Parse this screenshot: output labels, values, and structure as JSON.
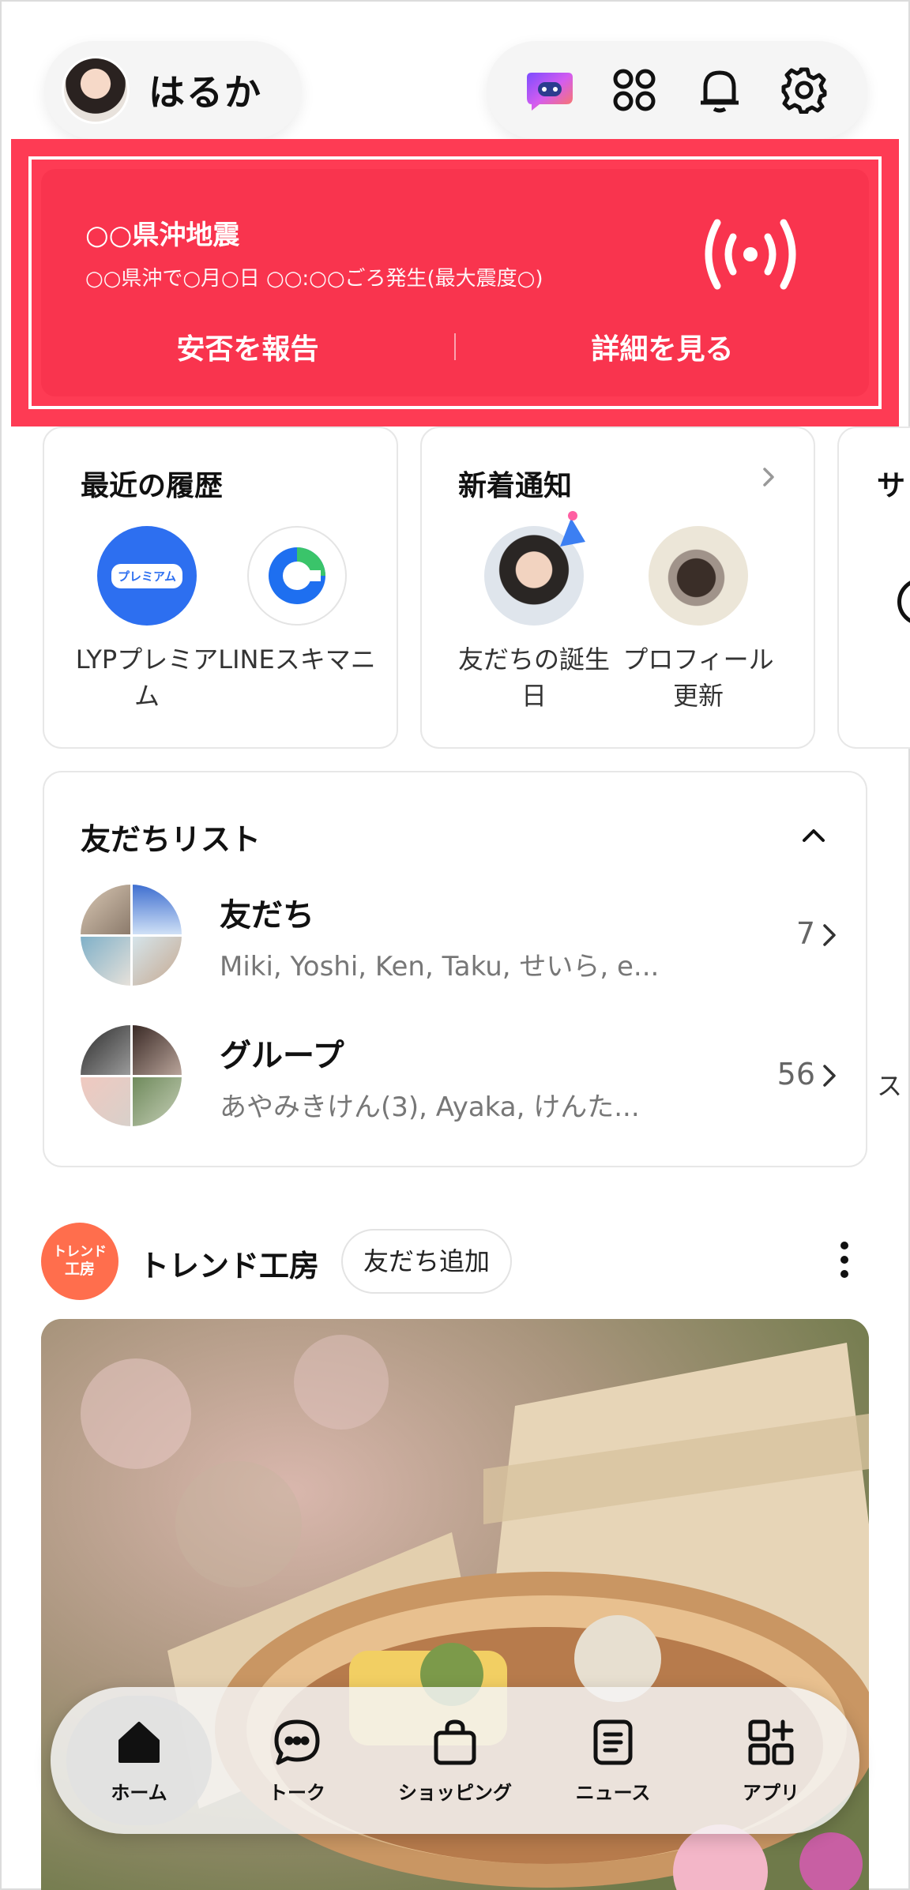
{
  "header": {
    "profile_name": "はるか",
    "icons": [
      "ai-assistant-icon",
      "apps-grid-icon",
      "bell-icon",
      "gear-icon"
    ]
  },
  "alert": {
    "title": "○○県沖地震",
    "subtitle": "○○県沖で○月○日 ○○:○○ごろ発生(最大震度○)",
    "report_label": "安否を報告",
    "details_label": "詳細を見る",
    "color": "#f9344e"
  },
  "recent": {
    "title": "最近の履歴",
    "items": [
      {
        "label": "LYPプレミアム",
        "icon_text": "プレミアム"
      },
      {
        "label": "LINEスキマニ"
      }
    ]
  },
  "notifications": {
    "title": "新着通知",
    "items": [
      {
        "label": "友だちの誕生日"
      },
      {
        "label": "プロフィール更新"
      }
    ]
  },
  "third_card": {
    "title_partial": "サ",
    "label_partial": "ス"
  },
  "friends_list": {
    "title": "友だちリスト",
    "rows": [
      {
        "title": "友だち",
        "subtitle": "Miki, Yoshi, Ken, Taku, せいら, e...",
        "count": "7"
      },
      {
        "title": "グループ",
        "subtitle": "あやみきけん(3), Ayaka, けんた...",
        "count": "56"
      }
    ]
  },
  "official_account": {
    "logo_line1": "トレンド",
    "logo_line2": "工房",
    "name": "トレンド工房",
    "add_friend_label": "友だち追加"
  },
  "bottom_nav": {
    "items": [
      {
        "label": "ホーム",
        "icon": "home-icon",
        "active": true
      },
      {
        "label": "トーク",
        "icon": "chat-icon",
        "active": false
      },
      {
        "label": "ショッピング",
        "icon": "shopping-bag-icon",
        "active": false
      },
      {
        "label": "ニュース",
        "icon": "news-icon",
        "active": false
      },
      {
        "label": "アプリ",
        "icon": "apps-icon",
        "active": false
      }
    ]
  }
}
